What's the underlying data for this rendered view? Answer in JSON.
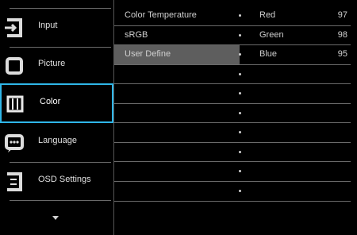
{
  "sidebar": {
    "items": [
      {
        "label": "Input",
        "icon": "input-icon"
      },
      {
        "label": "Picture",
        "icon": "picture-icon"
      },
      {
        "label": "Color",
        "icon": "color-icon",
        "active": true
      },
      {
        "label": "Language",
        "icon": "language-icon"
      },
      {
        "label": "OSD Settings",
        "icon": "osd-settings-icon"
      }
    ],
    "scroll_indicator": "chevron-down-icon"
  },
  "main": {
    "left_options": [
      "Color Temperature",
      "sRGB",
      "User Define",
      "",
      "",
      "",
      "",
      "",
      "",
      ""
    ],
    "selected_left": "User Define",
    "channels": [
      {
        "name": "Red",
        "value": "97"
      },
      {
        "name": "Green",
        "value": "98"
      },
      {
        "name": "Blue",
        "value": "95"
      }
    ]
  },
  "colors": {
    "accent": "#2fb6e8",
    "selected_bg": "#5e5e5e",
    "background": "#000000"
  }
}
